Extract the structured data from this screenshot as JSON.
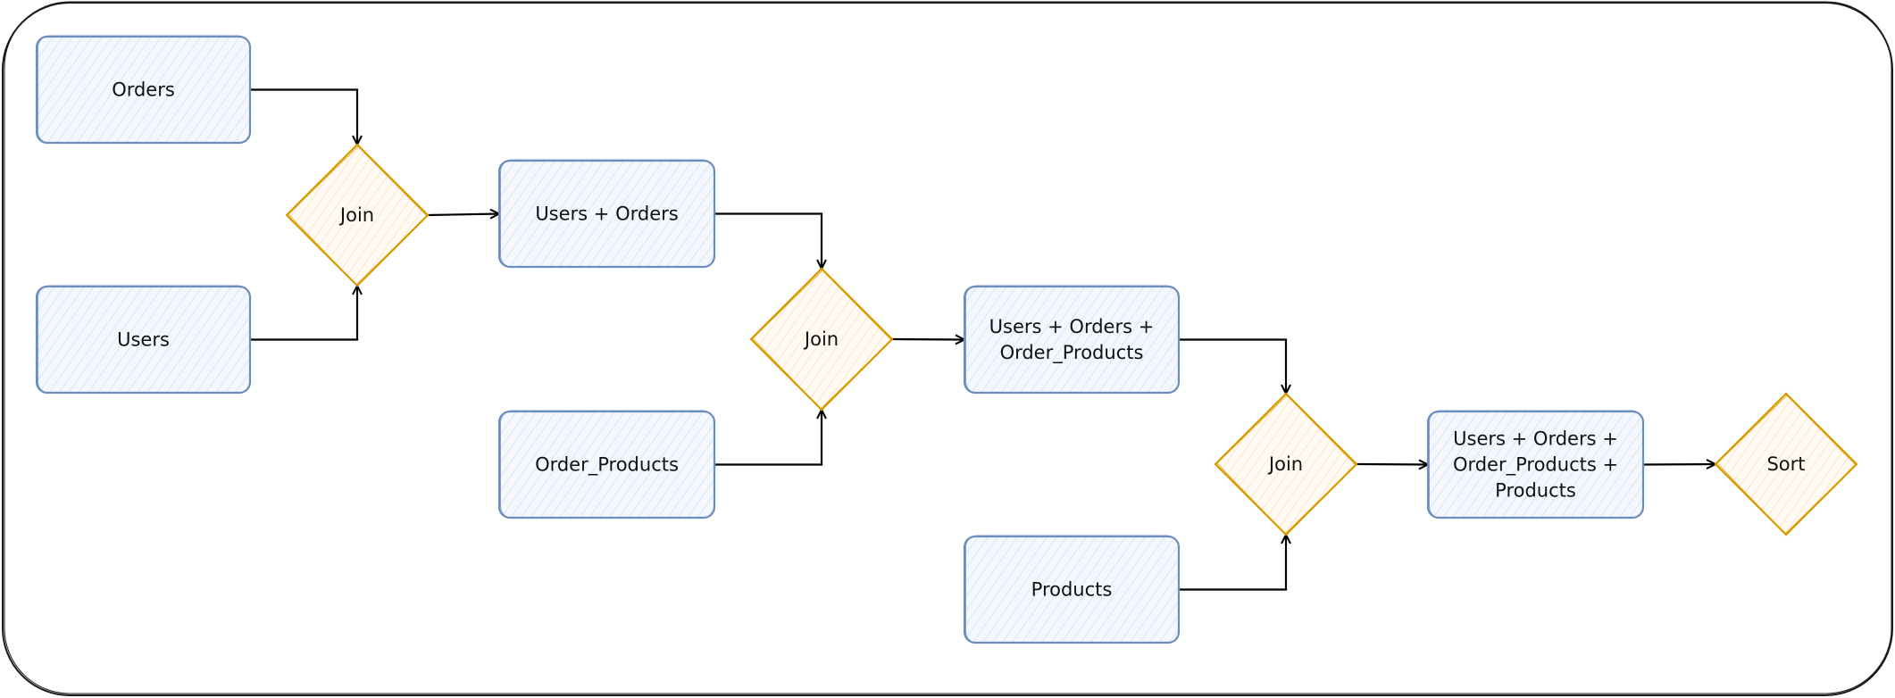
{
  "diagram": {
    "type": "flowchart",
    "colors": {
      "frame_stroke": "#1a1a1a",
      "table_stroke": "#6c8ebf",
      "table_fill": "#dae8fc",
      "op_stroke": "#d79b00",
      "op_fill": "#ffe6cc",
      "edge": "#000000"
    },
    "nodes": [
      {
        "id": "orders",
        "kind": "table",
        "lines": [
          "Orders"
        ]
      },
      {
        "id": "users",
        "kind": "table",
        "lines": [
          "Users"
        ]
      },
      {
        "id": "join1",
        "kind": "operation",
        "lines": [
          "Join"
        ]
      },
      {
        "id": "users_orders",
        "kind": "table",
        "lines": [
          "Users + Orders"
        ]
      },
      {
        "id": "order_products",
        "kind": "table",
        "lines": [
          "Order_Products"
        ]
      },
      {
        "id": "join2",
        "kind": "operation",
        "lines": [
          "Join"
        ]
      },
      {
        "id": "uo_op",
        "kind": "table",
        "lines": [
          "Users + Orders +",
          "Order_Products"
        ]
      },
      {
        "id": "products",
        "kind": "table",
        "lines": [
          "Products"
        ]
      },
      {
        "id": "join3",
        "kind": "operation",
        "lines": [
          "Join"
        ]
      },
      {
        "id": "uo_op_p",
        "kind": "table",
        "lines": [
          "Users + Orders +",
          "Order_Products +",
          "Products"
        ]
      },
      {
        "id": "sort",
        "kind": "operation",
        "lines": [
          "Sort"
        ]
      }
    ],
    "edges": [
      {
        "from": "orders",
        "to": "join1"
      },
      {
        "from": "users",
        "to": "join1"
      },
      {
        "from": "join1",
        "to": "users_orders"
      },
      {
        "from": "users_orders",
        "to": "join2"
      },
      {
        "from": "order_products",
        "to": "join2"
      },
      {
        "from": "join2",
        "to": "uo_op"
      },
      {
        "from": "uo_op",
        "to": "join3"
      },
      {
        "from": "products",
        "to": "join3"
      },
      {
        "from": "join3",
        "to": "uo_op_p"
      },
      {
        "from": "uo_op_p",
        "to": "sort"
      }
    ]
  }
}
